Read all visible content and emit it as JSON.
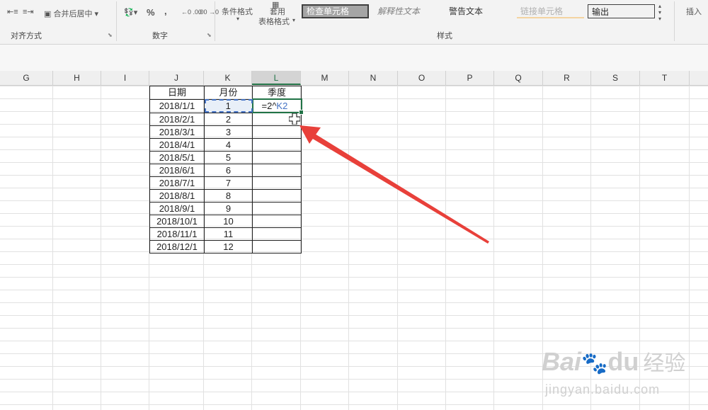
{
  "ribbon": {
    "alignment": {
      "merge_center": "合并后居中",
      "group_label": "对齐方式"
    },
    "number": {
      "percent": "%",
      "comma": ",",
      "inc_dec": "←0 .00",
      "dec_dec": ".00 →0",
      "group_label": "数字"
    },
    "styles": {
      "cond_format": "条件格式",
      "table_format_1": "套用",
      "table_format_2": "表格格式",
      "group_label": "样式",
      "cells": [
        {
          "label": "检查单元格",
          "bg": "#a5a5a5",
          "fg": "#ffffff"
        },
        {
          "label": "解释性文本",
          "bg": "#ffffff",
          "fg": "#7f7f7f"
        },
        {
          "label": "警告文本",
          "bg": "#ffffff",
          "fg": "#333333"
        },
        {
          "label": "链接单元格",
          "bg": "#ffffff",
          "fg": "#b0b0b0"
        },
        {
          "label": "输出",
          "bg": "#f2f2f2",
          "fg": "#222222"
        }
      ]
    },
    "insert": "插入"
  },
  "columns": [
    "G",
    "H",
    "I",
    "J",
    "K",
    "L",
    "M",
    "N",
    "O",
    "P",
    "Q",
    "R",
    "S",
    "T"
  ],
  "selected_column": "L",
  "table": {
    "headers": [
      "日期",
      "月份",
      "季度"
    ],
    "rows": [
      {
        "date": "2018/1/1",
        "month": "1"
      },
      {
        "date": "2018/2/1",
        "month": "2"
      },
      {
        "date": "2018/3/1",
        "month": "3"
      },
      {
        "date": "2018/4/1",
        "month": "4"
      },
      {
        "date": "2018/5/1",
        "month": "5"
      },
      {
        "date": "2018/6/1",
        "month": "6"
      },
      {
        "date": "2018/7/1",
        "month": "7"
      },
      {
        "date": "2018/8/1",
        "month": "8"
      },
      {
        "date": "2018/9/1",
        "month": "9"
      },
      {
        "date": "2018/10/1",
        "month": "10"
      },
      {
        "date": "2018/11/1",
        "month": "11"
      },
      {
        "date": "2018/12/1",
        "month": "12"
      }
    ],
    "formula_prefix": "=2^",
    "formula_ref": "K2"
  },
  "watermark": {
    "brand": "Bai",
    "brand2": "du",
    "text": "经验",
    "url": "jingyan.baidu.com"
  },
  "colors": {
    "accent": "#217346",
    "arrow": "#e8403a",
    "ref": "#4472c4"
  }
}
